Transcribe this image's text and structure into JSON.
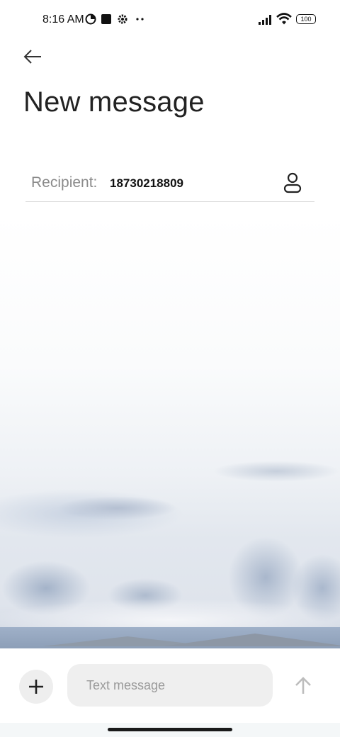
{
  "status_bar": {
    "time": "8:16 AM",
    "icons": [
      "data-saver-icon",
      "stop-square-icon",
      "settings-gear-icon",
      "more-dots-icon"
    ],
    "right_icons": [
      "signal-icon",
      "wifi-icon",
      "battery-icon"
    ],
    "battery": "100"
  },
  "header": {
    "back_icon": "arrow-left-icon",
    "title": "New message"
  },
  "recipient": {
    "label": "Recipient:",
    "value": "18730218809",
    "contact_icon": "person-icon"
  },
  "composer": {
    "add_icon": "plus-icon",
    "placeholder": "Text message",
    "value": "",
    "send_icon": "arrow-up-icon"
  },
  "colors": {
    "background": "#ffffff",
    "field_bg": "#efefef",
    "placeholder": "#9a9a9a",
    "send_disabled": "#bdbdbd"
  }
}
